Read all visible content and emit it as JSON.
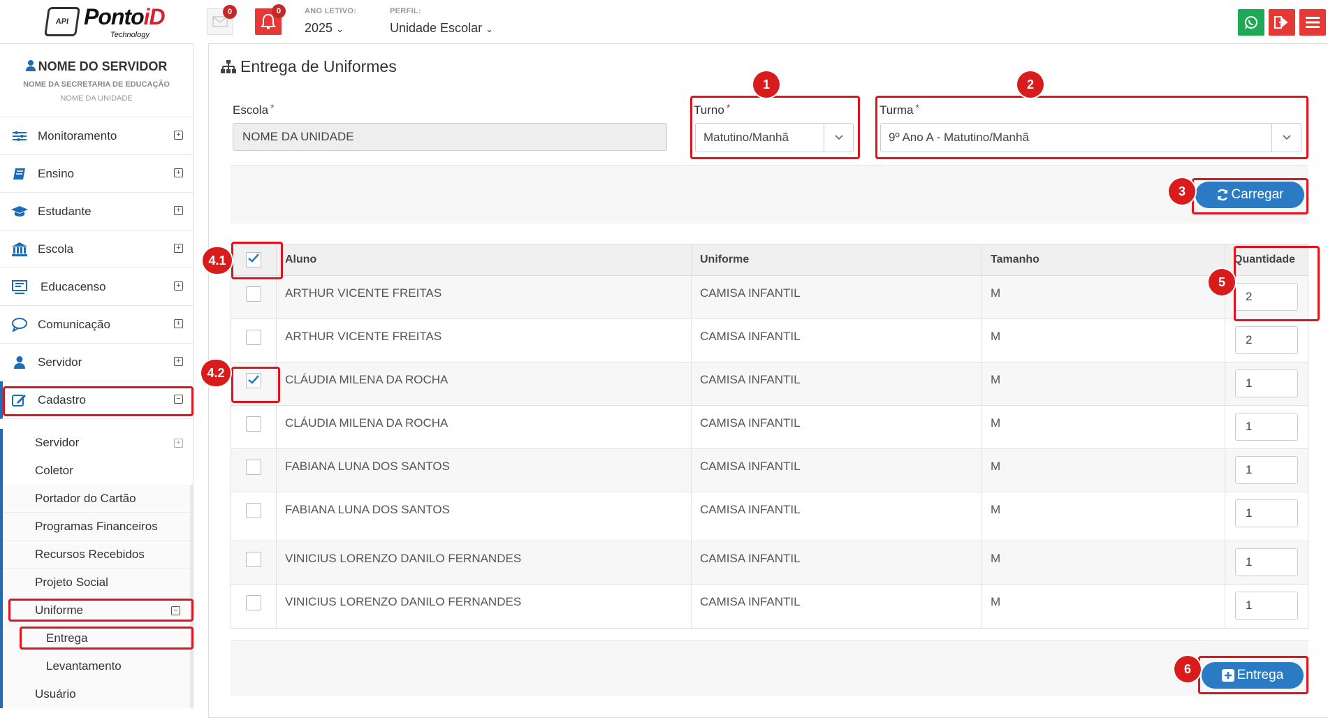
{
  "topbar": {
    "logo_brand_prefix": "Ponto",
    "logo_brand_suffix": "iD",
    "logo_tagline": "Technology",
    "logo_hex_text": "API",
    "mail_count": "0",
    "notif_count": "0",
    "ano_letivo_label": "ANO LETIVO:",
    "ano_letivo_value": "2025",
    "perfil_label": "PERFIL:",
    "perfil_value": "Unidade Escolar",
    "whatsapp_icon": "whatsapp-icon",
    "logout_icon": "logout-icon",
    "menu_icon": "hamburger-icon"
  },
  "user": {
    "name": "NOME DO SERVIDOR",
    "secretaria": "NOME DA SECRETARIA DE EDUCAÇÃO",
    "unidade": "NOME DA UNIDADE"
  },
  "sidebar": {
    "items": [
      {
        "label": "Monitoramento",
        "icon": "sliders-icon"
      },
      {
        "label": "Ensino",
        "icon": "book-icon"
      },
      {
        "label": "Estudante",
        "icon": "graduation-cap-icon"
      },
      {
        "label": "Escola",
        "icon": "bank-icon"
      },
      {
        "label": "Educacenso",
        "icon": "monitor-icon"
      },
      {
        "label": "Comunicação",
        "icon": "chat-icon"
      },
      {
        "label": "Servidor",
        "icon": "user-icon"
      },
      {
        "label": "Cadastro",
        "icon": "edit-icon"
      }
    ],
    "cadastro_sub": {
      "servidor": "Servidor",
      "coletor": "Coletor",
      "portador": "Portador do Cartão",
      "programas": "Programas Financeiros",
      "recursos": "Recursos Recebidos",
      "projeto": "Projeto Social",
      "uniforme": "Uniforme",
      "entrega": "Entrega",
      "levantamento": "Levantamento",
      "usuario": "Usuário"
    }
  },
  "page": {
    "title": "Entrega de Uniformes",
    "escola_label": "Escola",
    "escola_value": "NOME DA UNIDADE",
    "turno_label": "Turno",
    "turno_value": "Matutino/Manhã",
    "turma_label": "Turma",
    "turma_value": "9º Ano A - Matutino/Manhã",
    "required_mark": "*",
    "carregar_label": "Carregar",
    "entrega_label": "Entrega"
  },
  "table": {
    "headers": {
      "aluno": "Aluno",
      "uniforme": "Uniforme",
      "tamanho": "Tamanho",
      "quantidade": "Quantidade"
    },
    "header_checked": true,
    "rows": [
      {
        "aluno": "ARTHUR VICENTE FREITAS",
        "uniforme": "CAMISA INFANTIL",
        "tamanho": "M",
        "quantidade": "2",
        "checked": false
      },
      {
        "aluno": "ARTHUR VICENTE FREITAS",
        "uniforme": "CAMISA INFANTIL",
        "tamanho": "M",
        "quantidade": "2",
        "checked": false
      },
      {
        "aluno": "CLÁUDIA MILENA DA ROCHA",
        "uniforme": "CAMISA INFANTIL",
        "tamanho": "M",
        "quantidade": "1",
        "checked": true
      },
      {
        "aluno": "CLÁUDIA MILENA DA ROCHA",
        "uniforme": "CAMISA INFANTIL",
        "tamanho": "M",
        "quantidade": "1",
        "checked": false
      },
      {
        "aluno": "FABIANA LUNA DOS SANTOS",
        "uniforme": "CAMISA INFANTIL",
        "tamanho": "M",
        "quantidade": "1",
        "checked": false
      },
      {
        "aluno": "FABIANA LUNA DOS SANTOS",
        "uniforme": "CAMISA INFANTIL",
        "tamanho": "M",
        "quantidade": "1",
        "checked": false
      },
      {
        "aluno": "VINICIUS LORENZO DANILO FERNANDES",
        "uniforme": "CAMISA INFANTIL",
        "tamanho": "M",
        "quantidade": "1",
        "checked": false
      },
      {
        "aluno": "VINICIUS LORENZO DANILO FERNANDES",
        "uniforme": "CAMISA INFANTIL",
        "tamanho": "M",
        "quantidade": "1",
        "checked": false
      }
    ]
  },
  "annotations": {
    "n1": "1",
    "n2": "2",
    "n3": "3",
    "n41": "4.1",
    "n42": "4.2",
    "n5": "5",
    "n6": "6"
  },
  "colors": {
    "accent": "#2a7bc3",
    "sidebar_icon": "#1e6bb8",
    "highlight": "#e0141e",
    "danger": "#e53935",
    "whatsapp": "#1fa855"
  }
}
